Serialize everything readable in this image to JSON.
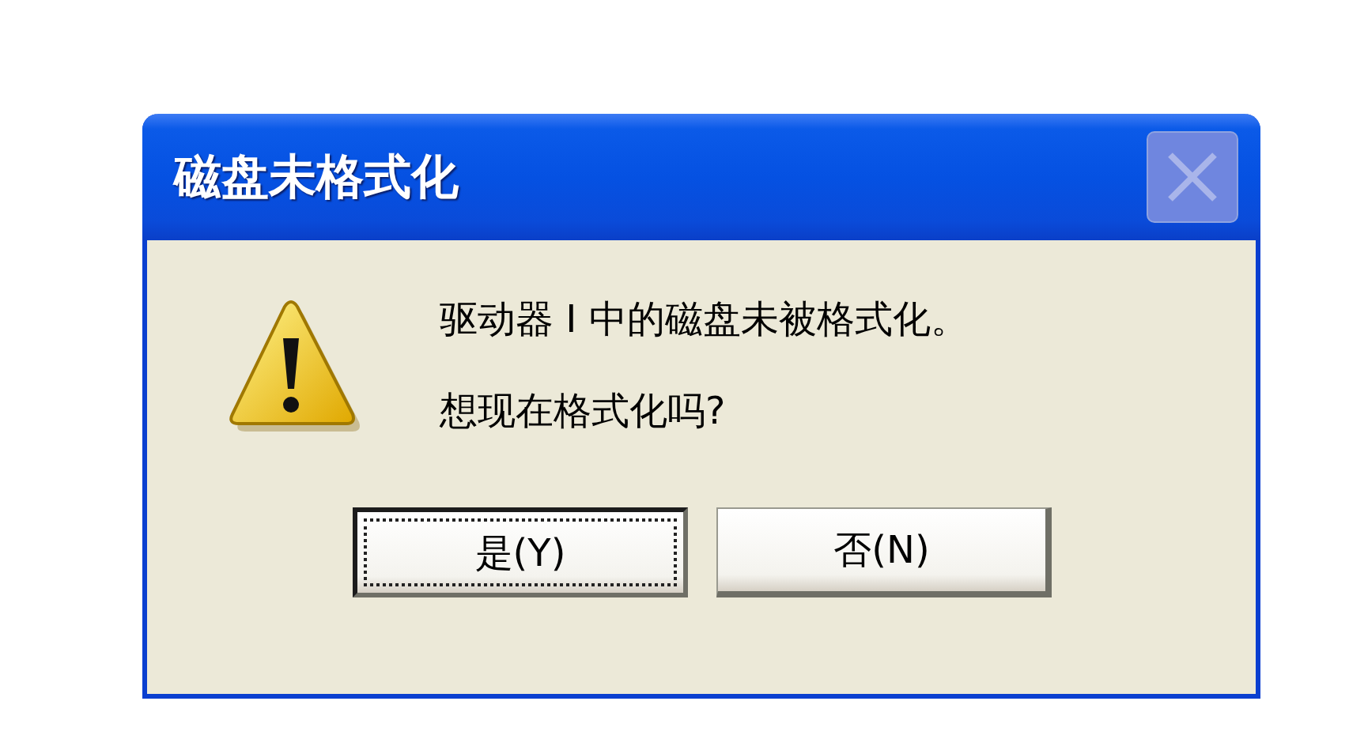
{
  "window": {
    "title": "磁盘未格式化",
    "close_disabled": true
  },
  "message": [
    "驱动器 I 中的磁盘未被格式化。",
    "想现在格式化吗?"
  ],
  "buttons": [
    {
      "label": "是(Y)",
      "focused": true
    },
    {
      "label": "否(N)",
      "focused": false
    }
  ]
}
